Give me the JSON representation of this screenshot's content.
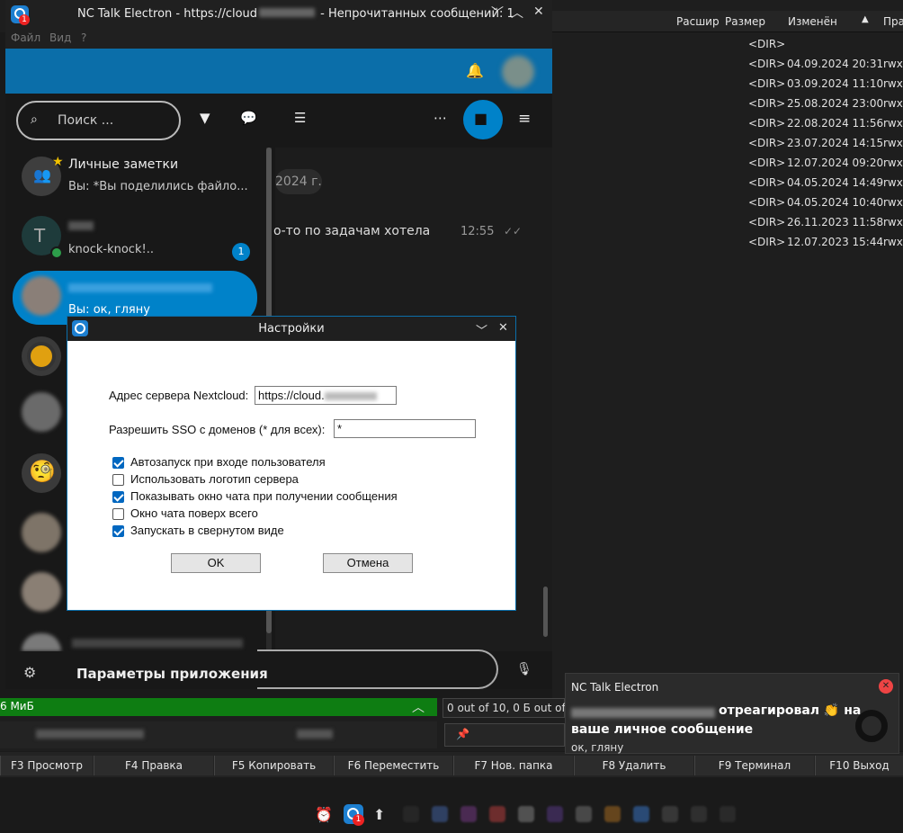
{
  "window": {
    "title": "NC Talk Electron - https://cloud",
    "title_suffix": " - Непрочитанных сообщений: 1",
    "badge": "1",
    "menu": [
      "Файл",
      "Вид",
      "?"
    ]
  },
  "toolbar": {
    "search_placeholder": "Поиск ..."
  },
  "conversations": [
    {
      "name": "Личные заметки",
      "message": "Вы: *Вы поделились файло...",
      "favorite": true
    },
    {
      "name": "",
      "message": "knock-knock!..",
      "unread": "1",
      "avatar_letter": "T"
    },
    {
      "name": "",
      "message": "Вы: ок, гляну",
      "selected": true
    }
  ],
  "chat": {
    "date_chip": "2024 г.",
    "message_text": "о-то по задачам хотела",
    "message_time": "12:55",
    "app_settings": "Параметры приложения"
  },
  "dialog": {
    "title": "Настройки",
    "server_label": "Адрес сервера Nextcloud:",
    "server_value": "https://cloud.",
    "sso_label": "Разрешить SSO с доменов (* для всех):",
    "sso_value": "*",
    "options": [
      {
        "label": "Автозапуск при входе пользователя",
        "checked": true
      },
      {
        "label": "Использовать логотип сервера",
        "checked": false
      },
      {
        "label": "Показывать окно чата при получении сообщения",
        "checked": true
      },
      {
        "label": "Окно чата поверх всего",
        "checked": false
      },
      {
        "label": "Запускать в свернутом виде",
        "checked": true
      }
    ],
    "ok": "OK",
    "cancel": "Отмена"
  },
  "file_manager": {
    "columns": [
      "Расшир",
      "Размер",
      "Изменён",
      "Пра"
    ],
    "rows": [
      {
        "size": "<DIR>",
        "date": "",
        "attr": ""
      },
      {
        "size": "<DIR>",
        "date": "04.09.2024 20:31",
        "attr": "rwx"
      },
      {
        "size": "<DIR>",
        "date": "03.09.2024 11:10",
        "attr": "rwx"
      },
      {
        "size": "<DIR>",
        "date": "25.08.2024 23:00",
        "attr": "rwx"
      },
      {
        "size": "<DIR>",
        "date": "22.08.2024 11:56",
        "attr": "rwx"
      },
      {
        "size": "<DIR>",
        "date": "23.07.2024 14:15",
        "attr": "rwx"
      },
      {
        "size": "<DIR>",
        "date": "12.07.2024 09:20",
        "attr": "rwx"
      },
      {
        "size": "<DIR>",
        "date": "04.05.2024 14:49",
        "attr": "rwx"
      },
      {
        "size": "<DIR>",
        "date": "04.05.2024 10:40",
        "attr": "rwx"
      },
      {
        "size": "<DIR>",
        "date": "26.11.2023 11:58",
        "attr": "rwx"
      },
      {
        "size": "<DIR>",
        "date": "12.07.2023 15:44",
        "attr": "rwx"
      }
    ],
    "status_left": "6 МиБ",
    "status_right": "0 out of 10, 0 Б out of"
  },
  "fkeys": [
    "F3 Просмотр",
    "F4 Правка",
    "F5 Копировать",
    "F6 Переместить",
    "F7 Нов. папка",
    "F8 Удалить",
    "F9 Терминал",
    "F10 Выход"
  ],
  "notification": {
    "app": "NC Talk Electron",
    "line1": "отреагировал 👏 на",
    "line2": "ваше личное сообщение",
    "line3": "ок, гляну"
  },
  "colors": {
    "accent": "#0082c9",
    "header": "#0b6ea9",
    "checkbox": "#0067c0",
    "online": "#2d9d4a"
  }
}
